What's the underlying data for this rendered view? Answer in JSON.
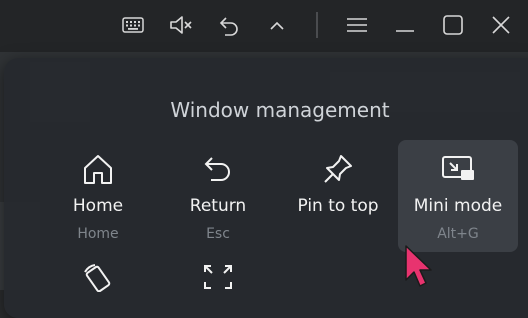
{
  "titlebar": {
    "icons": [
      "keyboard-icon",
      "mute-icon",
      "undo-icon",
      "chevron-up-icon",
      "menu-icon",
      "minimize-icon",
      "maximize-icon",
      "close-icon"
    ]
  },
  "panel": {
    "title": "Window management",
    "tiles": [
      {
        "label": "Home",
        "shortcut": "Home",
        "icon": "home-icon"
      },
      {
        "label": "Return",
        "shortcut": "Esc",
        "icon": "return-icon"
      },
      {
        "label": "Pin to top",
        "shortcut": "",
        "icon": "pin-icon"
      },
      {
        "label": "Mini mode",
        "shortcut": "Alt+G",
        "icon": "mini-mode-icon"
      }
    ],
    "second_row_icons": [
      "rotate-icon",
      "fullscreen-icon"
    ]
  },
  "colors": {
    "accent_cursor": "#e8336f",
    "panel_bg": "#26292e",
    "active_tile": "#3b3f45"
  }
}
